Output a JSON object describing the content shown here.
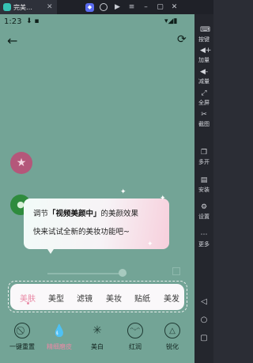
{
  "emulator": {
    "tab_title": "完美…",
    "sidebar": [
      {
        "icon": "keyboard-icon",
        "label": "按键"
      },
      {
        "icon": "volume-up-icon",
        "label": "加量"
      },
      {
        "icon": "volume-down-icon",
        "label": "减量"
      },
      {
        "icon": "fullscreen-icon",
        "label": "全屏"
      },
      {
        "icon": "scissors-icon",
        "label": "截图"
      },
      {
        "icon": "multi-window-icon",
        "label": "多开"
      },
      {
        "icon": "install-icon",
        "label": "安装"
      },
      {
        "icon": "settings-icon",
        "label": "设置"
      },
      {
        "icon": "more-icon",
        "label": "更多"
      }
    ]
  },
  "status_bar": {
    "time": "1:23"
  },
  "tooltip": {
    "prefix": "调节",
    "highlight": "「视频美颜中」",
    "suffix": "的美颜效果",
    "line2": "快来试试全新的美妆功能吧~"
  },
  "category_tabs": [
    "美肤",
    "美型",
    "滤镜",
    "美妆",
    "贴纸",
    "美发"
  ],
  "active_tab": "美肤",
  "tools": [
    {
      "icon": "slash-circle-icon",
      "label": "一键重置"
    },
    {
      "icon": "droplet-icon",
      "label": "精细磨皮"
    },
    {
      "icon": "sparkle-icon",
      "label": "美白"
    },
    {
      "icon": "face-icon",
      "label": "红润"
    },
    {
      "icon": "triangle-circle-icon",
      "label": "锐化"
    }
  ],
  "active_tool": "精细磨皮"
}
